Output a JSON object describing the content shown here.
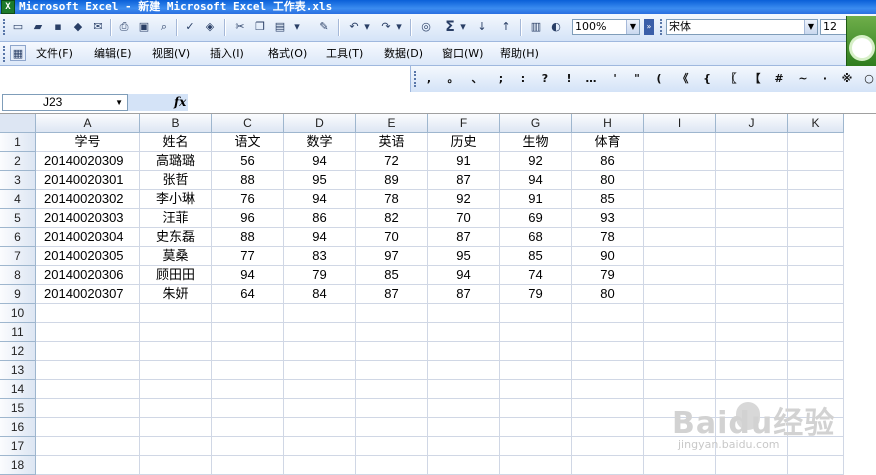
{
  "window": {
    "title": "Microsoft Excel - 新建 Microsoft Excel 工作表.xls"
  },
  "toolbar": {
    "zoom": "100%",
    "font_name": "宋体",
    "font_size": "12",
    "autosum_label": "Σ"
  },
  "menu": {
    "items": [
      "文件(F)",
      "编辑(E)",
      "视图(V)",
      "插入(I)",
      "格式(O)",
      "工具(T)",
      "数据(D)",
      "窗口(W)",
      "帮助(H)"
    ]
  },
  "symbols": [
    ",",
    "。",
    "、",
    ";",
    ":",
    "?",
    "!",
    "…",
    "'",
    "\"",
    "(",
    "《",
    "{",
    "〖",
    "【",
    "#",
    "~",
    "·",
    "※",
    "○"
  ],
  "formula_bar": {
    "name_box": "J23",
    "fx_label": "fx",
    "formula": ""
  },
  "sheet": {
    "columns": [
      "A",
      "B",
      "C",
      "D",
      "E",
      "F",
      "G",
      "H",
      "I",
      "J",
      "K"
    ],
    "row_numbers": [
      "1",
      "2",
      "3",
      "4",
      "5",
      "6",
      "7",
      "8",
      "9",
      "10",
      "11",
      "12",
      "13",
      "14",
      "15",
      "16",
      "17",
      "18"
    ],
    "cells": [
      [
        "学号",
        "姓名",
        "语文",
        "数学",
        "英语",
        "历史",
        "生物",
        "体育"
      ],
      [
        "20140020309",
        "高璐璐",
        "56",
        "94",
        "72",
        "91",
        "92",
        "86"
      ],
      [
        "20140020301",
        "张哲",
        "88",
        "95",
        "89",
        "87",
        "94",
        "80"
      ],
      [
        "20140020302",
        "李小琳",
        "76",
        "94",
        "78",
        "92",
        "91",
        "85"
      ],
      [
        "20140020303",
        "汪菲",
        "96",
        "86",
        "82",
        "70",
        "69",
        "93"
      ],
      [
        "20140020304",
        "史东磊",
        "88",
        "94",
        "70",
        "87",
        "68",
        "78"
      ],
      [
        "20140020305",
        "莫桑",
        "77",
        "83",
        "97",
        "95",
        "85",
        "90"
      ],
      [
        "20140020306",
        "顾田田",
        "94",
        "79",
        "85",
        "94",
        "74",
        "79"
      ],
      [
        "20140020307",
        "朱妍",
        "64",
        "84",
        "87",
        "87",
        "79",
        "80"
      ]
    ]
  },
  "watermark": {
    "logo": "Baidu经验",
    "url": "jingyan.baidu.com"
  }
}
